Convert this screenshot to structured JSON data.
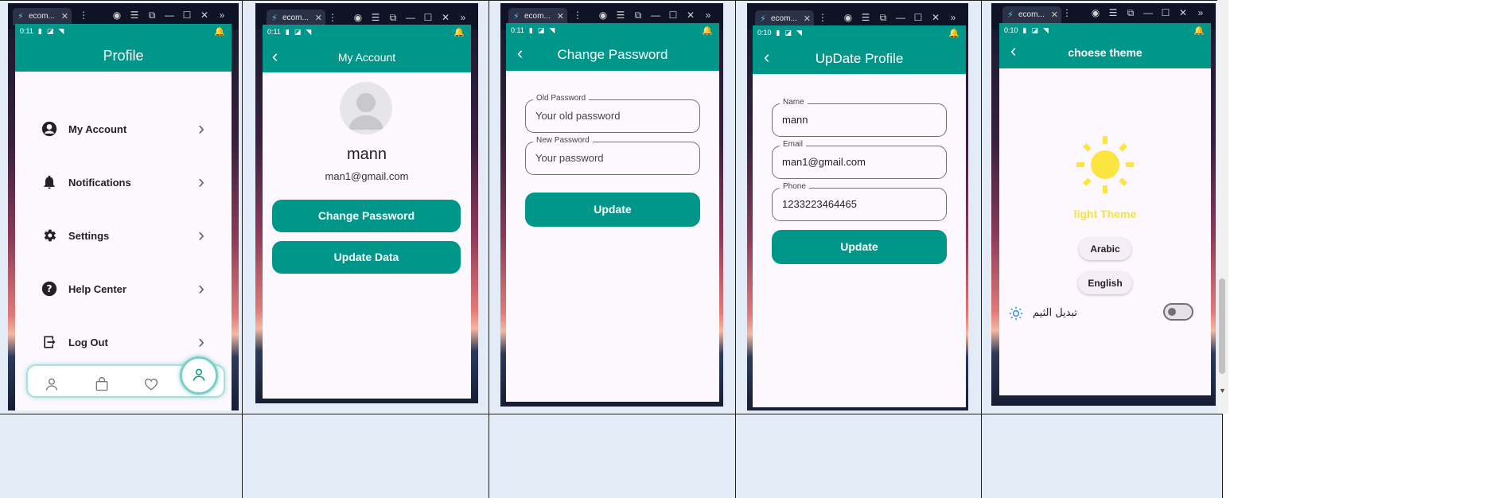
{
  "tab_title": "ecom...",
  "status_time": "0:11",
  "status_time_alt": "0:10",
  "profile": {
    "title": "Profile",
    "menu": [
      {
        "label": "My Account",
        "icon": "account-circle-icon"
      },
      {
        "label": "Notifications",
        "icon": "bell-icon"
      },
      {
        "label": "Settings",
        "icon": "gear-icon"
      },
      {
        "label": "Help Center",
        "icon": "help-icon"
      },
      {
        "label": "Log Out",
        "icon": "logout-icon"
      }
    ]
  },
  "account": {
    "title": "My Account",
    "name": "mann",
    "email": "man1@gmail.com",
    "change_password": "Change Password",
    "update_data": "Update Data"
  },
  "change_password": {
    "title": "Change Password",
    "old_label": "Old Password",
    "old_placeholder": "Your old password",
    "new_label": "New Password",
    "new_placeholder": "Your password",
    "button": "Update"
  },
  "update_profile": {
    "title": "UpDate Profile",
    "name_label": "Name",
    "name_value": "mann",
    "email_label": "Email",
    "email_value": "man1@gmail.com",
    "phone_label": "Phone",
    "phone_value": "1233223464465",
    "button": "Update"
  },
  "theme": {
    "title": "choese theme",
    "theme_label": "light Theme",
    "arabic": "Arabic",
    "english": "English",
    "toggle_label": "تبديل الثيم",
    "toggle_on": false
  },
  "colors": {
    "primary": "#00978a",
    "sun": "#fde541",
    "theme_label": "#f7e33c"
  }
}
